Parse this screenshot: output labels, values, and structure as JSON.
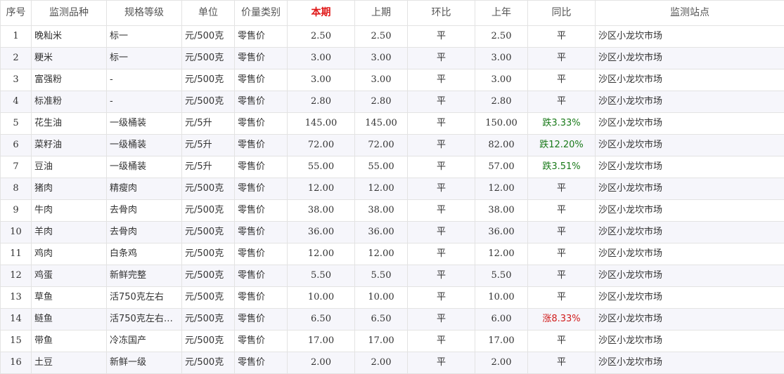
{
  "headers": {
    "idx": "序号",
    "item": "监测品种",
    "spec": "规格等级",
    "unit": "单位",
    "price_type": "价量类别",
    "current": "本期",
    "previous": "上期",
    "mom": "环比",
    "last_year": "上年",
    "yoy": "同比",
    "station": "监测站点"
  },
  "colors": {
    "current_header": "#e01818",
    "fall": "#1a7a1a",
    "rise": "#d01c1c"
  },
  "rows": [
    {
      "idx": "1",
      "item": "晚籼米",
      "spec": "标一",
      "unit": "元/500克",
      "price_type": "零售价",
      "current": "2.50",
      "previous": "2.50",
      "mom": "平",
      "last_year": "2.50",
      "yoy": "平",
      "yoy_dir": "flat",
      "station": "沙区小龙坎市场"
    },
    {
      "idx": "2",
      "item": "粳米",
      "spec": "标一",
      "unit": "元/500克",
      "price_type": "零售价",
      "current": "3.00",
      "previous": "3.00",
      "mom": "平",
      "last_year": "3.00",
      "yoy": "平",
      "yoy_dir": "flat",
      "station": "沙区小龙坎市场"
    },
    {
      "idx": "3",
      "item": "富强粉",
      "spec": "-",
      "unit": "元/500克",
      "price_type": "零售价",
      "current": "3.00",
      "previous": "3.00",
      "mom": "平",
      "last_year": "3.00",
      "yoy": "平",
      "yoy_dir": "flat",
      "station": "沙区小龙坎市场"
    },
    {
      "idx": "4",
      "item": "标准粉",
      "spec": "-",
      "unit": "元/500克",
      "price_type": "零售价",
      "current": "2.80",
      "previous": "2.80",
      "mom": "平",
      "last_year": "2.80",
      "yoy": "平",
      "yoy_dir": "flat",
      "station": "沙区小龙坎市场"
    },
    {
      "idx": "5",
      "item": "花生油",
      "spec": "一级桶装",
      "unit": "元/5升",
      "price_type": "零售价",
      "current": "145.00",
      "previous": "145.00",
      "mom": "平",
      "last_year": "150.00",
      "yoy": "跌3.33%",
      "yoy_dir": "fall",
      "station": "沙区小龙坎市场"
    },
    {
      "idx": "6",
      "item": "菜籽油",
      "spec": "一级桶装",
      "unit": "元/5升",
      "price_type": "零售价",
      "current": "72.00",
      "previous": "72.00",
      "mom": "平",
      "last_year": "82.00",
      "yoy": "跌12.20%",
      "yoy_dir": "fall",
      "station": "沙区小龙坎市场"
    },
    {
      "idx": "7",
      "item": "豆油",
      "spec": "一级桶装",
      "unit": "元/5升",
      "price_type": "零售价",
      "current": "55.00",
      "previous": "55.00",
      "mom": "平",
      "last_year": "57.00",
      "yoy": "跌3.51%",
      "yoy_dir": "fall",
      "station": "沙区小龙坎市场"
    },
    {
      "idx": "8",
      "item": "猪肉",
      "spec": "精瘦肉",
      "unit": "元/500克",
      "price_type": "零售价",
      "current": "12.00",
      "previous": "12.00",
      "mom": "平",
      "last_year": "12.00",
      "yoy": "平",
      "yoy_dir": "flat",
      "station": "沙区小龙坎市场"
    },
    {
      "idx": "9",
      "item": "牛肉",
      "spec": "去骨肉",
      "unit": "元/500克",
      "price_type": "零售价",
      "current": "38.00",
      "previous": "38.00",
      "mom": "平",
      "last_year": "38.00",
      "yoy": "平",
      "yoy_dir": "flat",
      "station": "沙区小龙坎市场"
    },
    {
      "idx": "10",
      "item": "羊肉",
      "spec": "去骨肉",
      "unit": "元/500克",
      "price_type": "零售价",
      "current": "36.00",
      "previous": "36.00",
      "mom": "平",
      "last_year": "36.00",
      "yoy": "平",
      "yoy_dir": "flat",
      "station": "沙区小龙坎市场"
    },
    {
      "idx": "11",
      "item": "鸡肉",
      "spec": "白条鸡",
      "unit": "元/500克",
      "price_type": "零售价",
      "current": "12.00",
      "previous": "12.00",
      "mom": "平",
      "last_year": "12.00",
      "yoy": "平",
      "yoy_dir": "flat",
      "station": "沙区小龙坎市场"
    },
    {
      "idx": "12",
      "item": "鸡蛋",
      "spec": "新鲜完整",
      "unit": "元/500克",
      "price_type": "零售价",
      "current": "5.50",
      "previous": "5.50",
      "mom": "平",
      "last_year": "5.50",
      "yoy": "平",
      "yoy_dir": "flat",
      "station": "沙区小龙坎市场"
    },
    {
      "idx": "13",
      "item": "草鱼",
      "spec": "活750克左右",
      "unit": "元/500克",
      "price_type": "零售价",
      "current": "10.00",
      "previous": "10.00",
      "mom": "平",
      "last_year": "10.00",
      "yoy": "平",
      "yoy_dir": "flat",
      "station": "沙区小龙坎市场"
    },
    {
      "idx": "14",
      "item": "鲢鱼",
      "spec": "活750克左右…",
      "unit": "元/500克",
      "price_type": "零售价",
      "current": "6.50",
      "previous": "6.50",
      "mom": "平",
      "last_year": "6.00",
      "yoy": "涨8.33%",
      "yoy_dir": "rise",
      "station": "沙区小龙坎市场"
    },
    {
      "idx": "15",
      "item": "带鱼",
      "spec": "冷冻国产",
      "unit": "元/500克",
      "price_type": "零售价",
      "current": "17.00",
      "previous": "17.00",
      "mom": "平",
      "last_year": "17.00",
      "yoy": "平",
      "yoy_dir": "flat",
      "station": "沙区小龙坎市场"
    },
    {
      "idx": "16",
      "item": "土豆",
      "spec": "新鲜一级",
      "unit": "元/500克",
      "price_type": "零售价",
      "current": "2.00",
      "previous": "2.00",
      "mom": "平",
      "last_year": "2.00",
      "yoy": "平",
      "yoy_dir": "flat",
      "station": "沙区小龙坎市场"
    }
  ]
}
